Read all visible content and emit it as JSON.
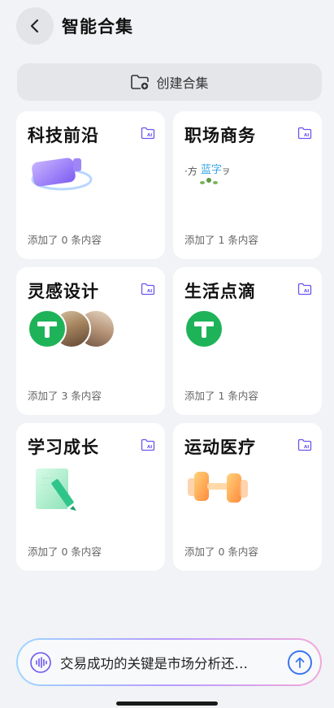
{
  "header": {
    "back_icon": "chevron-left-icon",
    "title": "智能合集"
  },
  "create_button": {
    "icon": "folder-add-icon",
    "label": "创建合集"
  },
  "collections": [
    {
      "title": "科技前沿",
      "count_text": "添加了 0 条内容",
      "visual": "purple-gadget-illustration"
    },
    {
      "title": "职场商务",
      "count_text": "添加了 1 条内容",
      "visual": "brand-logo-image"
    },
    {
      "title": "灵感设计",
      "count_text": "添加了 3 条内容",
      "visual": "thumbnail-stack"
    },
    {
      "title": "生活点滴",
      "count_text": "添加了 1 条内容",
      "visual": "green-logo-thumbnail"
    },
    {
      "title": "学习成长",
      "count_text": "添加了 0 条内容",
      "visual": "notebook-pencil-illustration"
    },
    {
      "title": "运动医疗",
      "count_text": "添加了 0 条内容",
      "visual": "dumbbell-illustration"
    }
  ],
  "bottom_input": {
    "voice_icon": "voice-wave-icon",
    "text": "交易成功的关键是市场分析还…",
    "send_icon": "arrow-up-icon"
  },
  "colors": {
    "background": "#f1f3f6",
    "accent": "#3a76f0",
    "card_ai_icon": "#6b56f0"
  }
}
